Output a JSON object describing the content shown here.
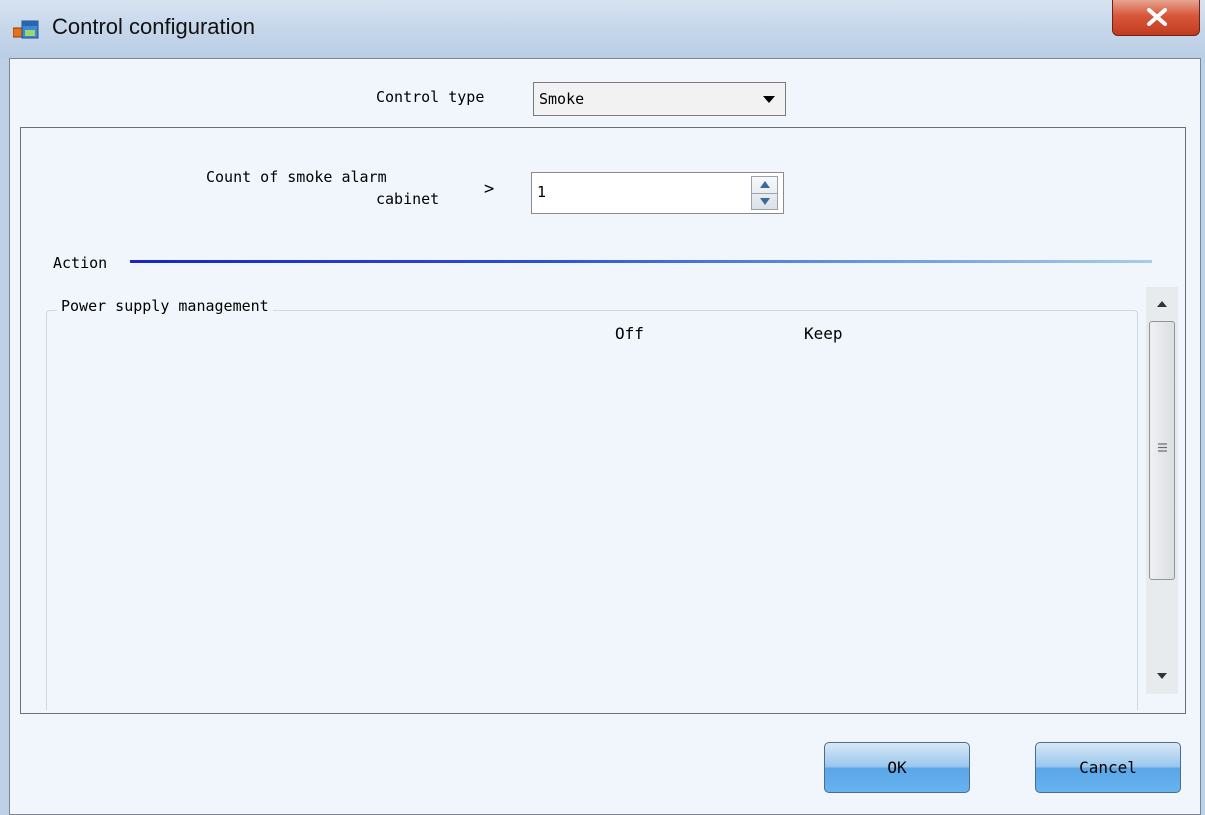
{
  "window": {
    "title": "Control configuration"
  },
  "control_type": {
    "label": "Control type",
    "value": "Smoke"
  },
  "count": {
    "label_line1": "Count of smoke alarm",
    "label_line2": "cabinet",
    "operator": ">",
    "value": "1"
  },
  "action": {
    "label": "Action"
  },
  "power": {
    "title": "Power supply management",
    "columns": [
      "Off",
      "Keep"
    ]
  },
  "buttons": {
    "ok": "OK",
    "cancel": "Cancel"
  }
}
